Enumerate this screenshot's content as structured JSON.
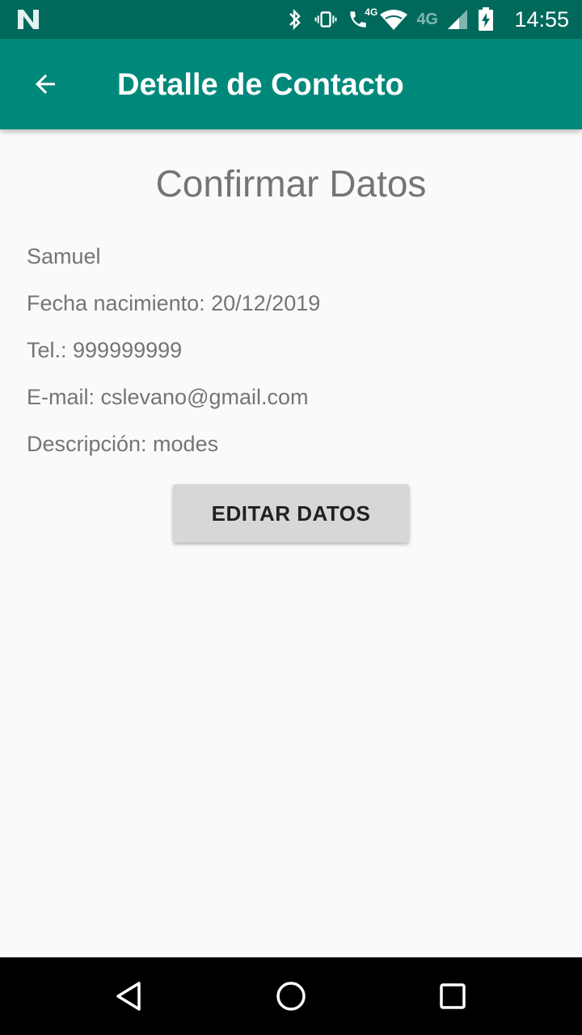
{
  "status_bar": {
    "time": "14:55",
    "network_label": "4G",
    "call_badge": "4G",
    "icons": [
      "n-logo-icon",
      "bluetooth-icon",
      "vibrate-icon",
      "wifi-calling-icon",
      "wifi-icon",
      "signal-icon",
      "battery-charging-icon"
    ],
    "background": "#00695c"
  },
  "app_bar": {
    "title": "Detalle de Contacto",
    "back_icon": "arrow-back-icon",
    "background": "#00897b"
  },
  "main": {
    "heading": "Confirmar Datos",
    "name": "Samuel",
    "birth_date": "Fecha nacimiento: 20/12/2019",
    "phone": "Tel.: 999999999",
    "email": "E-mail: cslevano@gmail.com",
    "description": "Descripción: modes",
    "edit_button_label": "EDITAR DATOS"
  },
  "nav_bar": {
    "icons": [
      "back-triangle-icon",
      "home-circle-icon",
      "recents-square-icon"
    ]
  }
}
